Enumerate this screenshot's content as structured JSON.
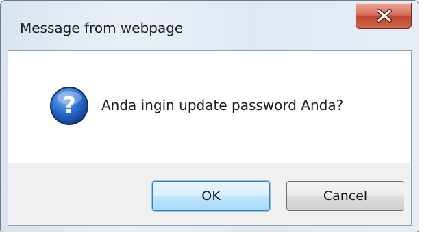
{
  "dialog": {
    "title": "Message from webpage",
    "message": "Anda ingin update password Anda?",
    "icon": "question-icon",
    "buttons": {
      "ok_label": "OK",
      "cancel_label": "Cancel"
    },
    "close_icon": "close-icon"
  },
  "colors": {
    "close_button": "#c2432c",
    "question_icon": "#1f5fb8",
    "default_button_border": "#3c7fb1"
  }
}
